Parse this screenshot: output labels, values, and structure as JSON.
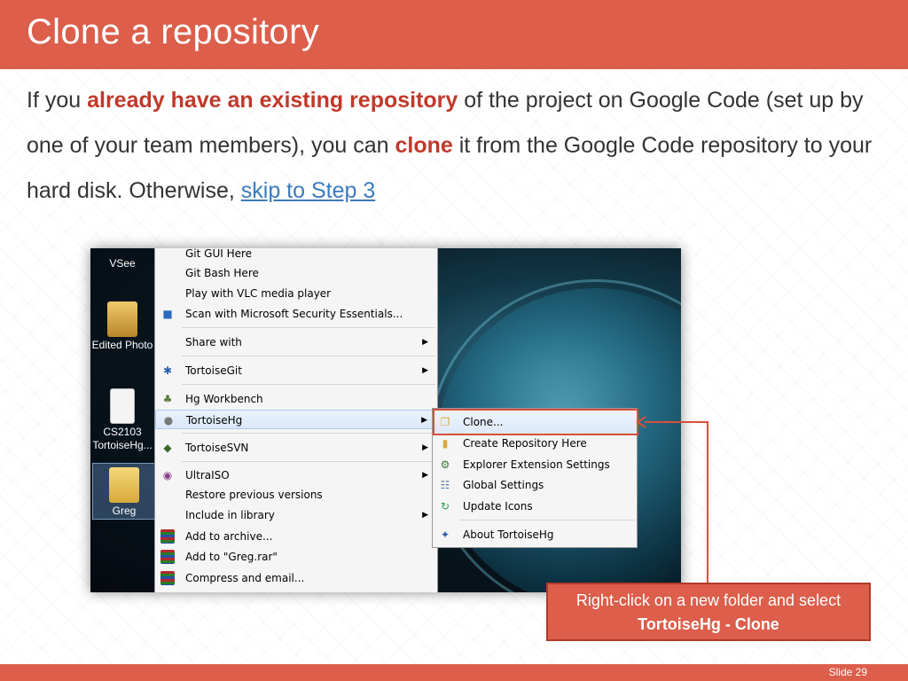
{
  "slide": {
    "title": "Clone a repository",
    "body": {
      "t1": "If you ",
      "h1": "already have an existing repository",
      "t2": " of the project on Google Code (set up by one of your team members), you can ",
      "h2": "clone",
      "t3": " it from the Google Code repository to your hard disk. Otherwise, ",
      "link": "skip to Step 3"
    },
    "callout": {
      "line1": "Right-click on a new folder and select",
      "line2": "TortoiseHg - Clone"
    },
    "footer": "Slide 29",
    "colors": {
      "accent": "#dc5e4b",
      "highlight_text": "#c0392b",
      "link": "#3b7bbf"
    }
  },
  "desktop_icons": [
    "VSee",
    "Edited Photo",
    "CS2103 TortoiseHg...",
    "Greg"
  ],
  "context_menu": {
    "items": [
      {
        "label": "Git GUI Here",
        "icon": "git-icon"
      },
      {
        "label": "Git Bash Here",
        "icon": "git-icon"
      },
      {
        "label": "Play with VLC media player",
        "icon": ""
      },
      {
        "label": "Scan with Microsoft Security Essentials...",
        "icon": "shield-icon"
      },
      {
        "label": "Share with",
        "icon": "",
        "submenu": true
      },
      {
        "label": "TortoiseGit",
        "icon": "tortoisegit-icon",
        "submenu": true
      },
      {
        "label": "Hg Workbench",
        "icon": "workbench-icon"
      },
      {
        "label": "TortoiseHg",
        "icon": "tortoisehg-icon",
        "submenu": true
      },
      {
        "label": "TortoiseSVN",
        "icon": "tortoisesvn-icon",
        "submenu": true
      },
      {
        "label": "UltraISO",
        "icon": "disc-icon",
        "submenu": true
      },
      {
        "label": "Restore previous versions",
        "icon": ""
      },
      {
        "label": "Include in library",
        "icon": "",
        "submenu": true
      },
      {
        "label": "Add to archive...",
        "icon": "winrar-icon"
      },
      {
        "label": "Add to \"Greg.rar\"",
        "icon": "winrar-icon"
      },
      {
        "label": "Compress and email...",
        "icon": "winrar-icon"
      }
    ]
  },
  "tortoisehg_submenu": {
    "items": [
      {
        "label": "Clone...",
        "icon": "clone-icon"
      },
      {
        "label": "Create Repository Here",
        "icon": "create-repo-icon"
      },
      {
        "label": "Explorer Extension Settings",
        "icon": "settings-icon"
      },
      {
        "label": "Global Settings",
        "icon": "global-settings-icon"
      },
      {
        "label": "Update Icons",
        "icon": "refresh-icon"
      },
      {
        "label": "About TortoiseHg",
        "icon": "about-icon"
      }
    ]
  }
}
